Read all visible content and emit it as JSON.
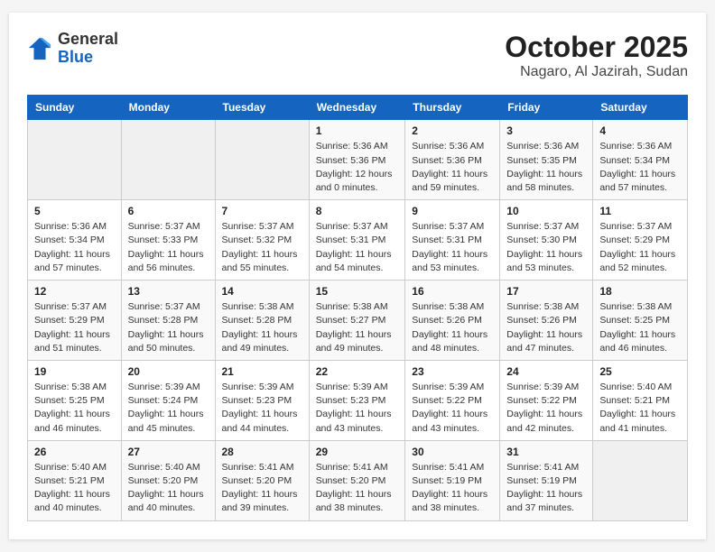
{
  "header": {
    "logo_general": "General",
    "logo_blue": "Blue",
    "month_title": "October 2025",
    "location": "Nagaro, Al Jazirah, Sudan"
  },
  "days_of_week": [
    "Sunday",
    "Monday",
    "Tuesday",
    "Wednesday",
    "Thursday",
    "Friday",
    "Saturday"
  ],
  "weeks": [
    [
      {
        "day": "",
        "sunrise": "",
        "sunset": "",
        "daylight": ""
      },
      {
        "day": "",
        "sunrise": "",
        "sunset": "",
        "daylight": ""
      },
      {
        "day": "",
        "sunrise": "",
        "sunset": "",
        "daylight": ""
      },
      {
        "day": "1",
        "sunrise": "Sunrise: 5:36 AM",
        "sunset": "Sunset: 5:36 PM",
        "daylight": "Daylight: 12 hours and 0 minutes."
      },
      {
        "day": "2",
        "sunrise": "Sunrise: 5:36 AM",
        "sunset": "Sunset: 5:36 PM",
        "daylight": "Daylight: 11 hours and 59 minutes."
      },
      {
        "day": "3",
        "sunrise": "Sunrise: 5:36 AM",
        "sunset": "Sunset: 5:35 PM",
        "daylight": "Daylight: 11 hours and 58 minutes."
      },
      {
        "day": "4",
        "sunrise": "Sunrise: 5:36 AM",
        "sunset": "Sunset: 5:34 PM",
        "daylight": "Daylight: 11 hours and 57 minutes."
      }
    ],
    [
      {
        "day": "5",
        "sunrise": "Sunrise: 5:36 AM",
        "sunset": "Sunset: 5:34 PM",
        "daylight": "Daylight: 11 hours and 57 minutes."
      },
      {
        "day": "6",
        "sunrise": "Sunrise: 5:37 AM",
        "sunset": "Sunset: 5:33 PM",
        "daylight": "Daylight: 11 hours and 56 minutes."
      },
      {
        "day": "7",
        "sunrise": "Sunrise: 5:37 AM",
        "sunset": "Sunset: 5:32 PM",
        "daylight": "Daylight: 11 hours and 55 minutes."
      },
      {
        "day": "8",
        "sunrise": "Sunrise: 5:37 AM",
        "sunset": "Sunset: 5:31 PM",
        "daylight": "Daylight: 11 hours and 54 minutes."
      },
      {
        "day": "9",
        "sunrise": "Sunrise: 5:37 AM",
        "sunset": "Sunset: 5:31 PM",
        "daylight": "Daylight: 11 hours and 53 minutes."
      },
      {
        "day": "10",
        "sunrise": "Sunrise: 5:37 AM",
        "sunset": "Sunset: 5:30 PM",
        "daylight": "Daylight: 11 hours and 53 minutes."
      },
      {
        "day": "11",
        "sunrise": "Sunrise: 5:37 AM",
        "sunset": "Sunset: 5:29 PM",
        "daylight": "Daylight: 11 hours and 52 minutes."
      }
    ],
    [
      {
        "day": "12",
        "sunrise": "Sunrise: 5:37 AM",
        "sunset": "Sunset: 5:29 PM",
        "daylight": "Daylight: 11 hours and 51 minutes."
      },
      {
        "day": "13",
        "sunrise": "Sunrise: 5:37 AM",
        "sunset": "Sunset: 5:28 PM",
        "daylight": "Daylight: 11 hours and 50 minutes."
      },
      {
        "day": "14",
        "sunrise": "Sunrise: 5:38 AM",
        "sunset": "Sunset: 5:28 PM",
        "daylight": "Daylight: 11 hours and 49 minutes."
      },
      {
        "day": "15",
        "sunrise": "Sunrise: 5:38 AM",
        "sunset": "Sunset: 5:27 PM",
        "daylight": "Daylight: 11 hours and 49 minutes."
      },
      {
        "day": "16",
        "sunrise": "Sunrise: 5:38 AM",
        "sunset": "Sunset: 5:26 PM",
        "daylight": "Daylight: 11 hours and 48 minutes."
      },
      {
        "day": "17",
        "sunrise": "Sunrise: 5:38 AM",
        "sunset": "Sunset: 5:26 PM",
        "daylight": "Daylight: 11 hours and 47 minutes."
      },
      {
        "day": "18",
        "sunrise": "Sunrise: 5:38 AM",
        "sunset": "Sunset: 5:25 PM",
        "daylight": "Daylight: 11 hours and 46 minutes."
      }
    ],
    [
      {
        "day": "19",
        "sunrise": "Sunrise: 5:38 AM",
        "sunset": "Sunset: 5:25 PM",
        "daylight": "Daylight: 11 hours and 46 minutes."
      },
      {
        "day": "20",
        "sunrise": "Sunrise: 5:39 AM",
        "sunset": "Sunset: 5:24 PM",
        "daylight": "Daylight: 11 hours and 45 minutes."
      },
      {
        "day": "21",
        "sunrise": "Sunrise: 5:39 AM",
        "sunset": "Sunset: 5:23 PM",
        "daylight": "Daylight: 11 hours and 44 minutes."
      },
      {
        "day": "22",
        "sunrise": "Sunrise: 5:39 AM",
        "sunset": "Sunset: 5:23 PM",
        "daylight": "Daylight: 11 hours and 43 minutes."
      },
      {
        "day": "23",
        "sunrise": "Sunrise: 5:39 AM",
        "sunset": "Sunset: 5:22 PM",
        "daylight": "Daylight: 11 hours and 43 minutes."
      },
      {
        "day": "24",
        "sunrise": "Sunrise: 5:39 AM",
        "sunset": "Sunset: 5:22 PM",
        "daylight": "Daylight: 11 hours and 42 minutes."
      },
      {
        "day": "25",
        "sunrise": "Sunrise: 5:40 AM",
        "sunset": "Sunset: 5:21 PM",
        "daylight": "Daylight: 11 hours and 41 minutes."
      }
    ],
    [
      {
        "day": "26",
        "sunrise": "Sunrise: 5:40 AM",
        "sunset": "Sunset: 5:21 PM",
        "daylight": "Daylight: 11 hours and 40 minutes."
      },
      {
        "day": "27",
        "sunrise": "Sunrise: 5:40 AM",
        "sunset": "Sunset: 5:20 PM",
        "daylight": "Daylight: 11 hours and 40 minutes."
      },
      {
        "day": "28",
        "sunrise": "Sunrise: 5:41 AM",
        "sunset": "Sunset: 5:20 PM",
        "daylight": "Daylight: 11 hours and 39 minutes."
      },
      {
        "day": "29",
        "sunrise": "Sunrise: 5:41 AM",
        "sunset": "Sunset: 5:20 PM",
        "daylight": "Daylight: 11 hours and 38 minutes."
      },
      {
        "day": "30",
        "sunrise": "Sunrise: 5:41 AM",
        "sunset": "Sunset: 5:19 PM",
        "daylight": "Daylight: 11 hours and 38 minutes."
      },
      {
        "day": "31",
        "sunrise": "Sunrise: 5:41 AM",
        "sunset": "Sunset: 5:19 PM",
        "daylight": "Daylight: 11 hours and 37 minutes."
      },
      {
        "day": "",
        "sunrise": "",
        "sunset": "",
        "daylight": ""
      }
    ]
  ]
}
